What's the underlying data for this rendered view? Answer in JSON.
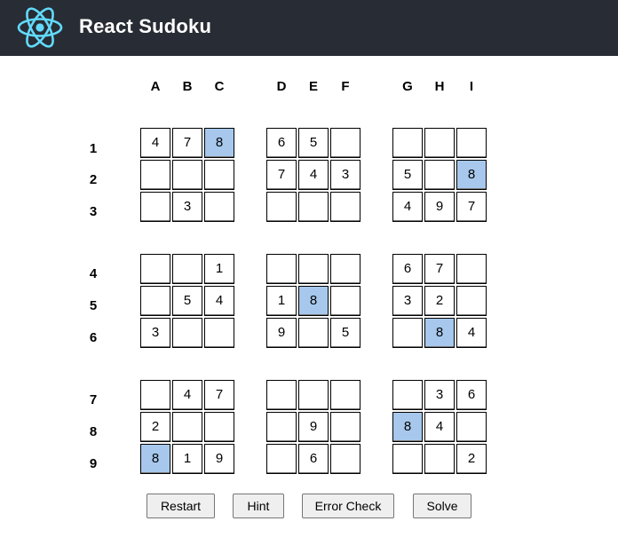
{
  "app": {
    "title": "React Sudoku"
  },
  "icons": {
    "logo": "react-atom-icon"
  },
  "colors": {
    "header_bg": "#282c34",
    "logo": "#61dafb",
    "highlight": "#a7c8ec"
  },
  "columns": [
    "A",
    "B",
    "C",
    "D",
    "E",
    "F",
    "G",
    "H",
    "I"
  ],
  "rows": [
    "1",
    "2",
    "3",
    "4",
    "5",
    "6",
    "7",
    "8",
    "9"
  ],
  "grid": [
    [
      "4",
      "7",
      "8",
      "6",
      "5",
      "",
      "",
      "",
      ""
    ],
    [
      "",
      "",
      "",
      "7",
      "4",
      "3",
      "5",
      "",
      "8"
    ],
    [
      "",
      "3",
      "",
      "",
      "",
      "",
      "4",
      "9",
      "7"
    ],
    [
      "",
      "",
      "1",
      "",
      "",
      "",
      "6",
      "7",
      ""
    ],
    [
      "",
      "5",
      "4",
      "1",
      "8",
      "",
      "3",
      "2",
      ""
    ],
    [
      "3",
      "",
      "",
      "9",
      "",
      "5",
      "",
      "8",
      "4"
    ],
    [
      "",
      "4",
      "7",
      "",
      "",
      "",
      "",
      "3",
      "6"
    ],
    [
      "2",
      "",
      "",
      "",
      "9",
      "",
      "8",
      "4",
      ""
    ],
    [
      "8",
      "1",
      "9",
      "",
      "6",
      "",
      "",
      "",
      "2"
    ]
  ],
  "highlighted_cells": [
    "C1",
    "I2",
    "E5",
    "H6",
    "G8",
    "A9"
  ],
  "buttons": {
    "restart": "Restart",
    "hint": "Hint",
    "error_check": "Error Check",
    "solve": "Solve"
  }
}
